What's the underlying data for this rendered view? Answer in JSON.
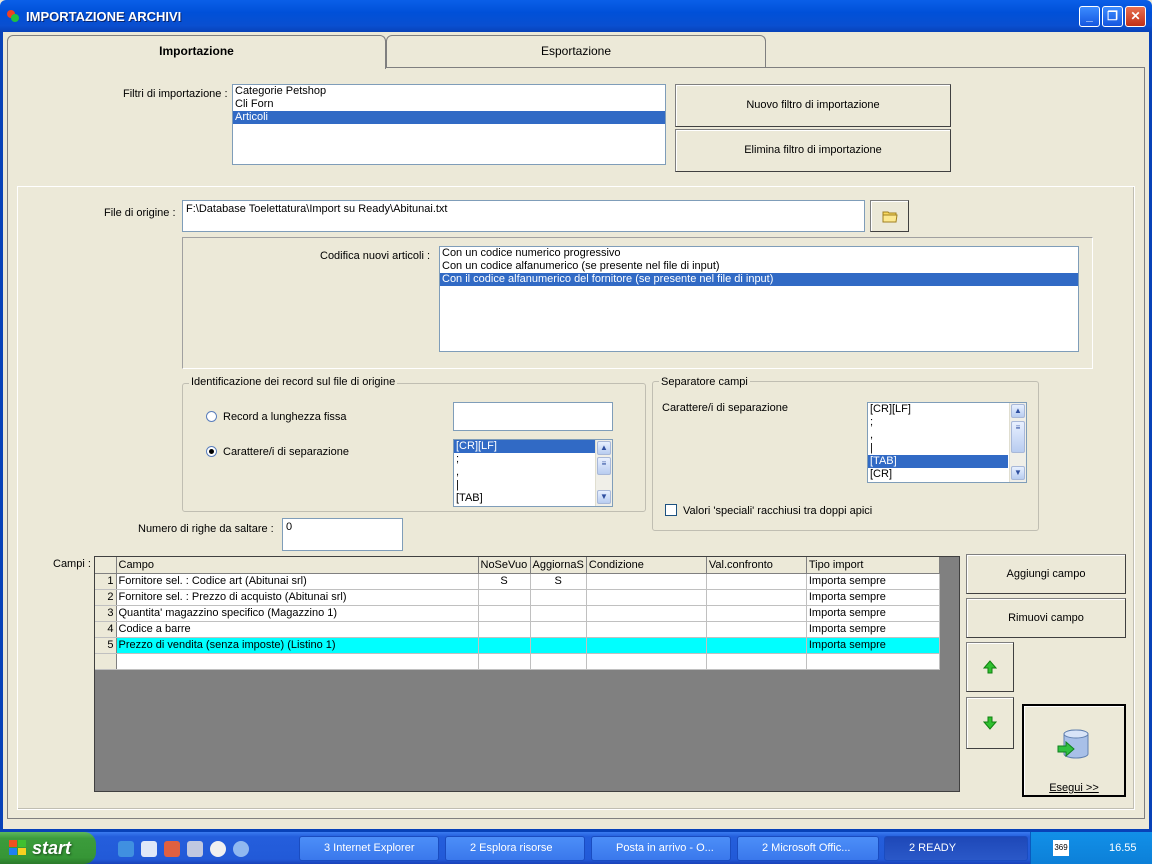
{
  "window": {
    "title": "IMPORTAZIONE ARCHIVI",
    "minimize": "_",
    "maximize": "❐",
    "close": "✕"
  },
  "tabs": [
    {
      "label": "Importazione",
      "active": true
    },
    {
      "label": "Esportazione",
      "active": false
    }
  ],
  "import_filters": {
    "label": "Filtri di importazione :",
    "items": [
      "Categorie Petshop",
      "Cli Forn",
      "Articoli"
    ],
    "selected": 2,
    "new_button": "Nuovo filtro di importazione",
    "delete_button": "Elimina filtro di importazione"
  },
  "source_file": {
    "label": "File di origine :",
    "value": "F:\\Database Toelettatura\\Import su Ready\\Abitunai.txt",
    "browse_icon": "folder-icon"
  },
  "coding": {
    "label": "Codifica nuovi articoli :",
    "items": [
      "Con un codice numerico progressivo",
      "Con un codice alfanumerico (se presente nel file di input)",
      "Con il codice alfanumerico del fornitore (se presente nel file di input)"
    ],
    "selected": 2
  },
  "record_id": {
    "title": "Identificazione dei record sul file di origine",
    "fixed_length_label": "Record a lunghezza fissa",
    "fixed_length_value": "",
    "separator_label": "Carattere/i di separazione",
    "selected_option": "separator",
    "separators": [
      "[CR][LF]",
      ";",
      ",",
      "|",
      "[TAB]"
    ],
    "selected": 0
  },
  "field_separator": {
    "title": "Separatore campi",
    "label": "Carattere/i di separazione",
    "separators": [
      "[CR][LF]",
      ";",
      ",",
      "|",
      "[TAB]",
      "[CR]"
    ],
    "selected": 4,
    "quotes_label": "Valori 'speciali' racchiusi tra doppi apici",
    "quotes_checked": false
  },
  "skip_rows": {
    "label": "Numero di righe da saltare  :",
    "value": "0"
  },
  "fields": {
    "label": "Campi :",
    "columns": [
      "",
      "Campo",
      "NoSeVuo",
      "AggiornaS",
      "Condizione",
      "Val.confronto",
      "Tipo import"
    ],
    "rows": [
      {
        "n": "1",
        "campo": "Fornitore sel. : Codice art (Abitunai srl)",
        "nosevuo": "S",
        "aggiorna": "S",
        "condizione": "",
        "valconfronto": "",
        "tipo": "Importa sempre"
      },
      {
        "n": "2",
        "campo": "Fornitore sel. : Prezzo di acquisto (Abitunai srl)",
        "nosevuo": "",
        "aggiorna": "",
        "condizione": "",
        "valconfronto": "",
        "tipo": "Importa sempre"
      },
      {
        "n": "3",
        "campo": "Quantita' magazzino specifico (Magazzino 1)",
        "nosevuo": "",
        "aggiorna": "",
        "condizione": "",
        "valconfronto": "",
        "tipo": "Importa sempre"
      },
      {
        "n": "4",
        "campo": "Codice a barre",
        "nosevuo": "",
        "aggiorna": "",
        "condizione": "",
        "valconfronto": "",
        "tipo": "Importa sempre"
      },
      {
        "n": "5",
        "campo": "Prezzo di vendita (senza imposte) (Listino 1)",
        "nosevuo": "",
        "aggiorna": "",
        "condizione": "",
        "valconfronto": "",
        "tipo": "Importa sempre"
      }
    ],
    "highlight_row": 4,
    "highlight_color": "#00FFFF",
    "add_button": "Aggiungi campo",
    "remove_button": "Rimuovi campo",
    "up_icon": "arrow-up-icon",
    "down_icon": "arrow-down-icon",
    "run_button": "Esegui >>"
  },
  "taskbar": {
    "start": "start",
    "items": [
      {
        "label": "3 Internet Explorer",
        "icon": "ie-icon"
      },
      {
        "label": "2 Esplora risorse",
        "icon": "folder-icon"
      },
      {
        "label": "Posta in arrivo - O...",
        "icon": "mail-icon"
      },
      {
        "label": "2 Microsoft Offic...",
        "icon": "excel-icon"
      },
      {
        "label": "2 READY",
        "icon": "ready-icon"
      }
    ],
    "tray_badge": "369",
    "clock": "16.55"
  }
}
